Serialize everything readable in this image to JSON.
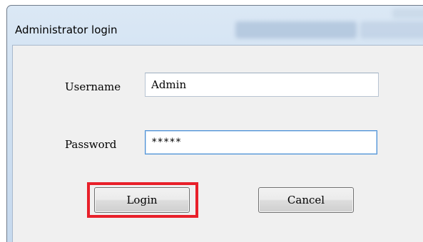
{
  "dialog": {
    "title": "Administrator login"
  },
  "form": {
    "username": {
      "label": "Username",
      "value": "Admin"
    },
    "password": {
      "label": "Password",
      "value": "*****"
    }
  },
  "buttons": {
    "login_label": "Login",
    "cancel_label": "Cancel"
  },
  "colors": {
    "highlight": "#e8202a",
    "focus_border": "#4a8fd6"
  }
}
